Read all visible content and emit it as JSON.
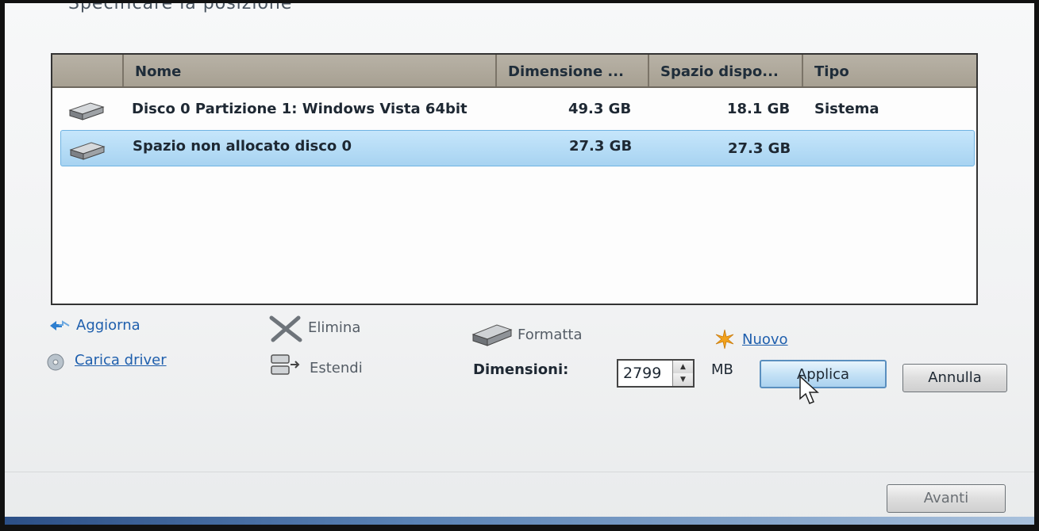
{
  "header": {
    "partial_title": "Specificare la posizione"
  },
  "list": {
    "columns": {
      "name": "Nome",
      "total": "Dimensione ...",
      "free": "Spazio dispo...",
      "type": "Tipo"
    },
    "rows": [
      {
        "name": "Disco 0 Partizione 1: Windows Vista 64bit",
        "total": "49.3 GB",
        "free": "18.1 GB",
        "type": "Sistema",
        "icon": "hard-disk-icon",
        "selected": false
      },
      {
        "name": "Spazio non allocato disco 0",
        "total": "27.3 GB",
        "free": "27.3 GB",
        "type": "",
        "icon": "hard-disk-icon",
        "selected": true
      }
    ]
  },
  "actions": {
    "refresh": "Aggiorna",
    "load_driver": "Carica driver",
    "delete": "Elimina",
    "extend": "Estendi",
    "format": "Formatta",
    "new": "Nuovo"
  },
  "size": {
    "label": "Dimensioni:",
    "value": "2799",
    "unit": "MB"
  },
  "buttons": {
    "apply": "Applica",
    "cancel": "Annulla",
    "next": "Avanti"
  },
  "colors": {
    "link": "#1f5fad",
    "selection": "#a7d3f1",
    "header_bg": "#a7a092"
  }
}
